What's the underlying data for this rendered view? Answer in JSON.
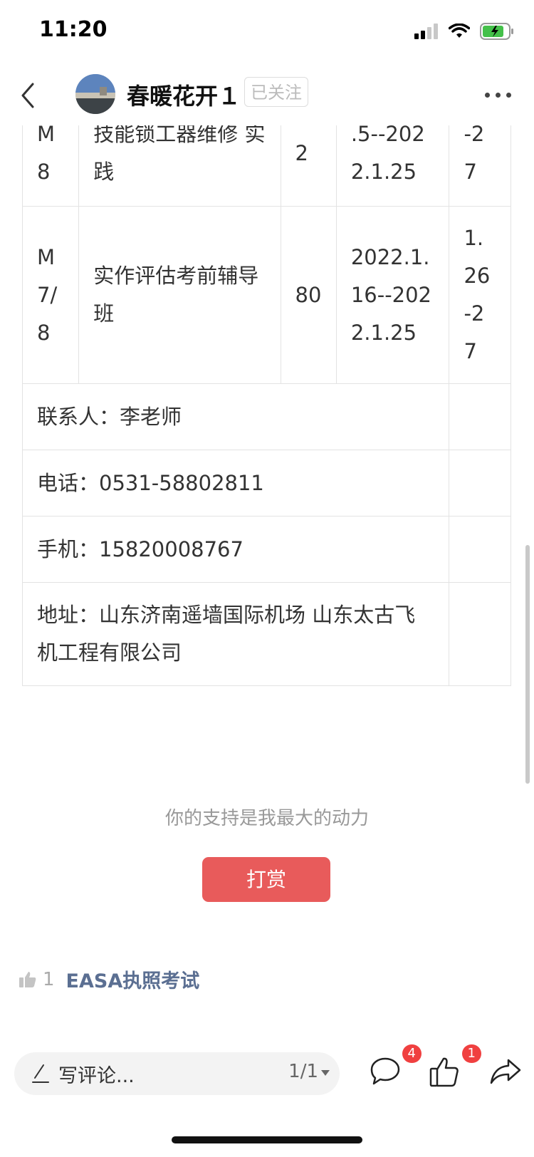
{
  "status": {
    "time": "11:20"
  },
  "header": {
    "username": "春暖花开１",
    "follow_label": "已关注"
  },
  "table": {
    "rows": [
      {
        "col1": "M 8",
        "col2": "技能锁工器维修 实践",
        "col3": "2",
        "col4": ".5--202 2.1.25",
        "col5": "-2 7"
      },
      {
        "col1": "M 7/ 8",
        "col2": "实作评估考前辅导班",
        "col3": "80",
        "col4": "2022.1. 16--202 2.1.25",
        "col5": "1. 26 -2 7"
      }
    ],
    "contact": [
      "联系人：李老师",
      "电话：0531-58802811",
      "手机：15820008767",
      "地址：山东济南遥墙国际机场 山东太古飞机工程有限公司"
    ]
  },
  "support": {
    "text": "你的支持是我最大的动力",
    "tip_button": "打赏"
  },
  "tags": {
    "like_count": "1",
    "tag_label": "EASA执照考试"
  },
  "bottom_bar": {
    "comment_placeholder": "写评论...",
    "page_indicator": "1/1",
    "comment_count": "4",
    "like_count": "1"
  }
}
